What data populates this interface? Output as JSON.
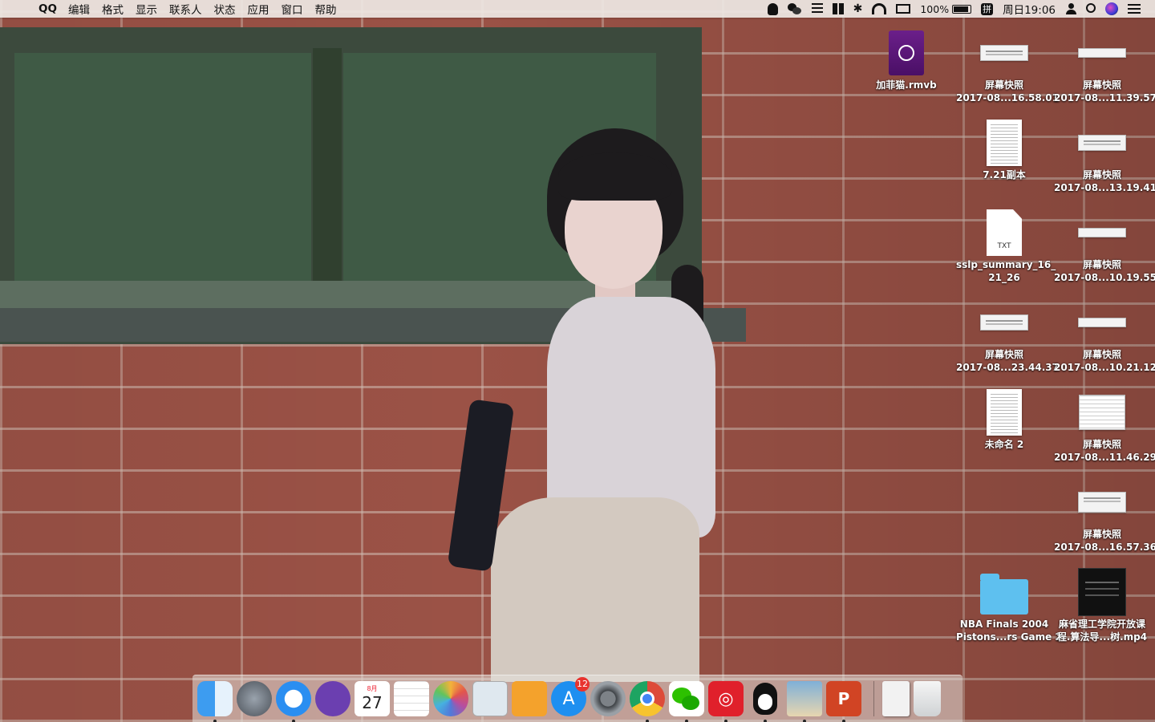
{
  "menubar": {
    "apple_glyph": "",
    "app_name": "QQ",
    "menus": [
      "编辑",
      "格式",
      "显示",
      "联系人",
      "状态",
      "应用",
      "窗口",
      "帮助"
    ],
    "tray": {
      "battery_percent": "100%",
      "input_method": "拼",
      "clock": "周日19:06",
      "bluetooth_glyph": "✱"
    }
  },
  "desktop": {
    "icons": [
      {
        "name": "加菲猫.rmvb",
        "kind": "movie-file"
      },
      {
        "line1": "屏幕快照",
        "line2": "2017-08...16.58.01",
        "kind": "screenshot"
      },
      {
        "line1": "屏幕快照",
        "line2": "2017-08...11.39.57",
        "kind": "screenshot"
      },
      {
        "name": "7.21副本",
        "kind": "document"
      },
      {
        "line1": "屏幕快照",
        "line2": "2017-08...13.19.41",
        "kind": "screenshot"
      },
      {
        "line1": "sslp_summary_16_",
        "line2": "21_26",
        "kind": "txt-file",
        "tag": "TXT"
      },
      {
        "line1": "屏幕快照",
        "line2": "2017-08...10.19.55",
        "kind": "screenshot"
      },
      {
        "line1": "屏幕快照",
        "line2": "2017-08...23.44.37",
        "kind": "screenshot"
      },
      {
        "line1": "屏幕快照",
        "line2": "2017-08...10.21.12",
        "kind": "screenshot"
      },
      {
        "name": "未命名 2",
        "kind": "document"
      },
      {
        "line1": "屏幕快照",
        "line2": "2017-08...11.46.29",
        "kind": "screenshot"
      },
      {
        "line1": "屏幕快照",
        "line2": "2017-08...16.57.36",
        "kind": "screenshot"
      },
      {
        "line1": "NBA Finals 2004",
        "line2": "Pistons...rs Game 2",
        "kind": "folder"
      },
      {
        "line1": "麻省理工学院开放课",
        "line2": "程.算法导...树.mp4",
        "kind": "video"
      }
    ]
  },
  "dock": {
    "apps": [
      {
        "name": "finder-icon"
      },
      {
        "name": "launchpad-icon"
      },
      {
        "name": "safari-icon"
      },
      {
        "name": "github-icon"
      },
      {
        "name": "calendar-icon"
      },
      {
        "name": "reminders-icon"
      },
      {
        "name": "photos-icon"
      },
      {
        "name": "preview-icon"
      },
      {
        "name": "pages-icon"
      },
      {
        "name": "app-store-icon"
      },
      {
        "name": "system-preferences-icon"
      },
      {
        "name": "chrome-icon"
      },
      {
        "name": "wechat-icon"
      },
      {
        "name": "netease-music-icon"
      },
      {
        "name": "qq-icon"
      },
      {
        "name": "image-viewer-icon"
      },
      {
        "name": "powerpoint-icon"
      },
      {
        "name": "documents-stack-icon"
      },
      {
        "name": "trash-icon"
      }
    ],
    "calendar_month": "8月",
    "calendar_day": "27",
    "app_store_badge": "12",
    "app_store_glyph": "A",
    "netease_glyph": "◎",
    "powerpoint_glyph": "P"
  },
  "colors": {
    "folder": "#5ec0ef",
    "badge": "#e8332f",
    "menubar": "#eee8e4"
  }
}
